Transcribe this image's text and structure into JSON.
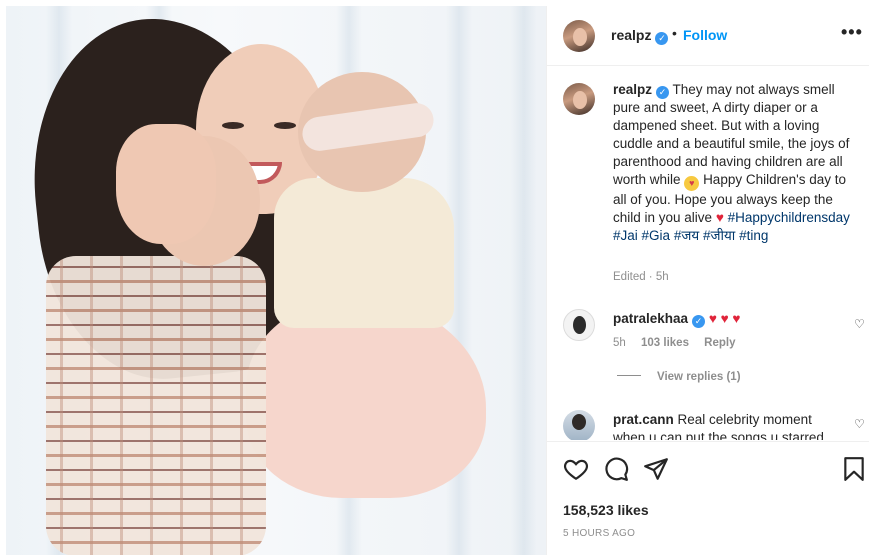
{
  "post": {
    "username": "realpz",
    "follow_label": "Follow",
    "dot": "•",
    "more": "•••"
  },
  "caption": {
    "username": "realpz",
    "text_1": "They may not always smell pure and sweet, A dirty diaper or a dampened sheet. But with a loving cuddle and a beautiful smile, the joys of parenthood and having children are all worth while",
    "text_2": "Happy Children's day to all of you. Hope you always keep the child in you alive",
    "hashtags": [
      "#Happychildrensday",
      "#Jai",
      "#Gia",
      "#जय",
      "#जीया",
      "#ting"
    ],
    "meta": "Edited · 5h"
  },
  "comments": [
    {
      "username": "patralekhaa",
      "text": "♥ ♥ ♥",
      "age": "5h",
      "likes": "103 likes",
      "reply": "Reply"
    },
    {
      "username": "prat.cann",
      "text": "Real celebrity moment when u can put the songs u starred"
    }
  ],
  "view_replies": "View replies (1)",
  "actions": {
    "icons": [
      "heart-icon",
      "comment-icon",
      "share-icon",
      "bookmark-icon"
    ]
  },
  "likes_count": "158,523 likes",
  "timestamp": "5 HOURS AGO",
  "colors": {
    "accent": "#0095f6",
    "verified": "#3897f0",
    "hashtag": "#00376b",
    "heart": "#e0243a",
    "muted": "#8e8e8e"
  }
}
